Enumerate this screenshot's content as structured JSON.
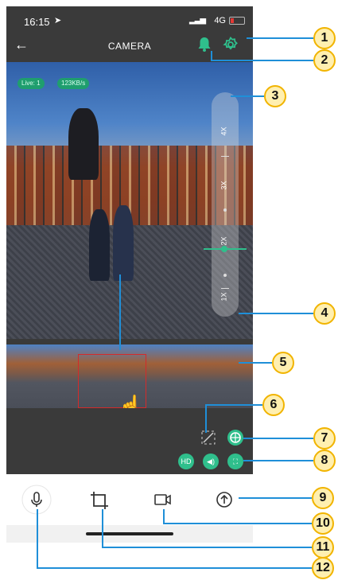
{
  "status_bar": {
    "time": "16:15",
    "network": "4G"
  },
  "nav": {
    "title": "CAMERA",
    "back_icon": "arrow-left-icon",
    "bell_icon": "bell-icon",
    "settings_icon": "gear-icon"
  },
  "video": {
    "live_label": "Live: 1",
    "bitrate_label": "123KB/s",
    "zoom_labels": [
      "4X",
      "3X",
      "2X",
      "1X"
    ]
  },
  "controls": {
    "hd_label": "HD",
    "icons": [
      "ptz-off-icon",
      "shutter-icon",
      "speaker-icon",
      "fullscreen-icon"
    ]
  },
  "bottom_bar": {
    "icons": [
      "microphone-icon",
      "crop-icon",
      "video-record-icon",
      "upload-icon"
    ]
  },
  "callouts": [
    "1",
    "2",
    "3",
    "4",
    "5",
    "6",
    "7",
    "8",
    "9",
    "10",
    "11",
    "12"
  ],
  "colors": {
    "accent": "#2fbf8c",
    "callout_fill": "#ffefb0",
    "callout_border": "#f1b400",
    "leader_line": "#1f8fd8"
  }
}
